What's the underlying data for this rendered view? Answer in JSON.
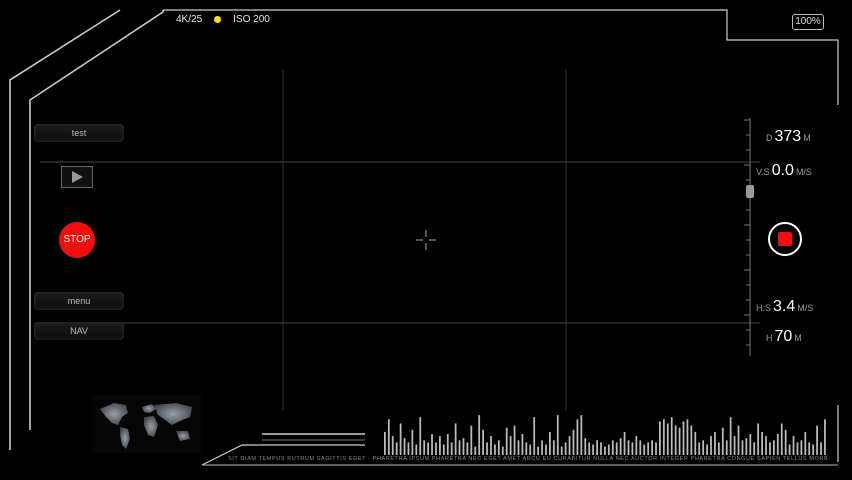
{
  "top_bar": {
    "resolution": "4K/25",
    "iso": "ISO 200",
    "indicator_color": "#ffe600",
    "battery": "100%"
  },
  "left_panel": {
    "test_label": "test",
    "menu_label": "menu",
    "nav_label": "NAV",
    "stop_label": "STOP",
    "stop_color": "#f20e0e"
  },
  "readouts": {
    "distance": {
      "prefix": "D",
      "value": "373",
      "unit": "M"
    },
    "vertical_speed": {
      "prefix": "V.S",
      "value": "0.0",
      "unit": "M/S"
    },
    "horizontal_speed": {
      "prefix": "H.S",
      "value": "3.4",
      "unit": "M/S"
    },
    "height": {
      "prefix": "H",
      "value": "70",
      "unit": "M"
    }
  },
  "record_button": {
    "color": "#f20e0e"
  },
  "ticker": {
    "text": "SIT DIAM TEMPUS RUTRUM SAGITTIS EGET - PHARETRA IPSUM PHARETRA NEC EGET AMET ARCU EU CURABITUR NULLA NEC AUCTOR INTEGER PHARETRA CONGUE SAPIEN TELLUS MORBI VITAE EROS SODALES LIGULA AM"
  },
  "audio_levels": [
    0.55,
    0.85,
    0.45,
    0.3,
    0.75,
    0.4,
    0.3,
    0.6,
    0.25,
    0.9,
    0.35,
    0.3,
    0.5,
    0.3,
    0.45,
    0.25,
    0.5,
    0.3,
    0.75,
    0.35,
    0.4,
    0.3,
    0.7,
    0.2,
    0.95,
    0.6,
    0.3,
    0.45,
    0.25,
    0.35,
    0.2,
    0.65,
    0.45,
    0.7,
    0.35,
    0.5,
    0.3,
    0.25,
    0.9,
    0.2,
    0.35,
    0.25,
    0.55,
    0.35,
    0.95,
    0.2,
    0.3,
    0.45,
    0.6,
    0.85,
    0.95,
    0.4,
    0.3,
    0.25,
    0.35,
    0.3,
    0.2,
    0.25,
    0.35,
    0.3,
    0.4,
    0.55,
    0.35,
    0.3,
    0.45,
    0.35,
    0.25,
    0.3,
    0.35,
    0.3,
    0.8,
    0.85,
    0.75,
    0.9,
    0.7,
    0.65,
    0.8,
    0.85,
    0.7,
    0.55,
    0.3,
    0.35,
    0.25,
    0.45,
    0.55,
    0.3,
    0.65,
    0.35,
    0.9,
    0.45,
    0.7,
    0.35,
    0.4,
    0.5,
    0.3,
    0.75,
    0.55,
    0.45,
    0.3,
    0.35,
    0.5,
    0.75,
    0.6,
    0.25,
    0.45,
    0.3,
    0.35,
    0.55,
    0.3,
    0.25,
    0.7,
    0.3,
    0.85
  ]
}
